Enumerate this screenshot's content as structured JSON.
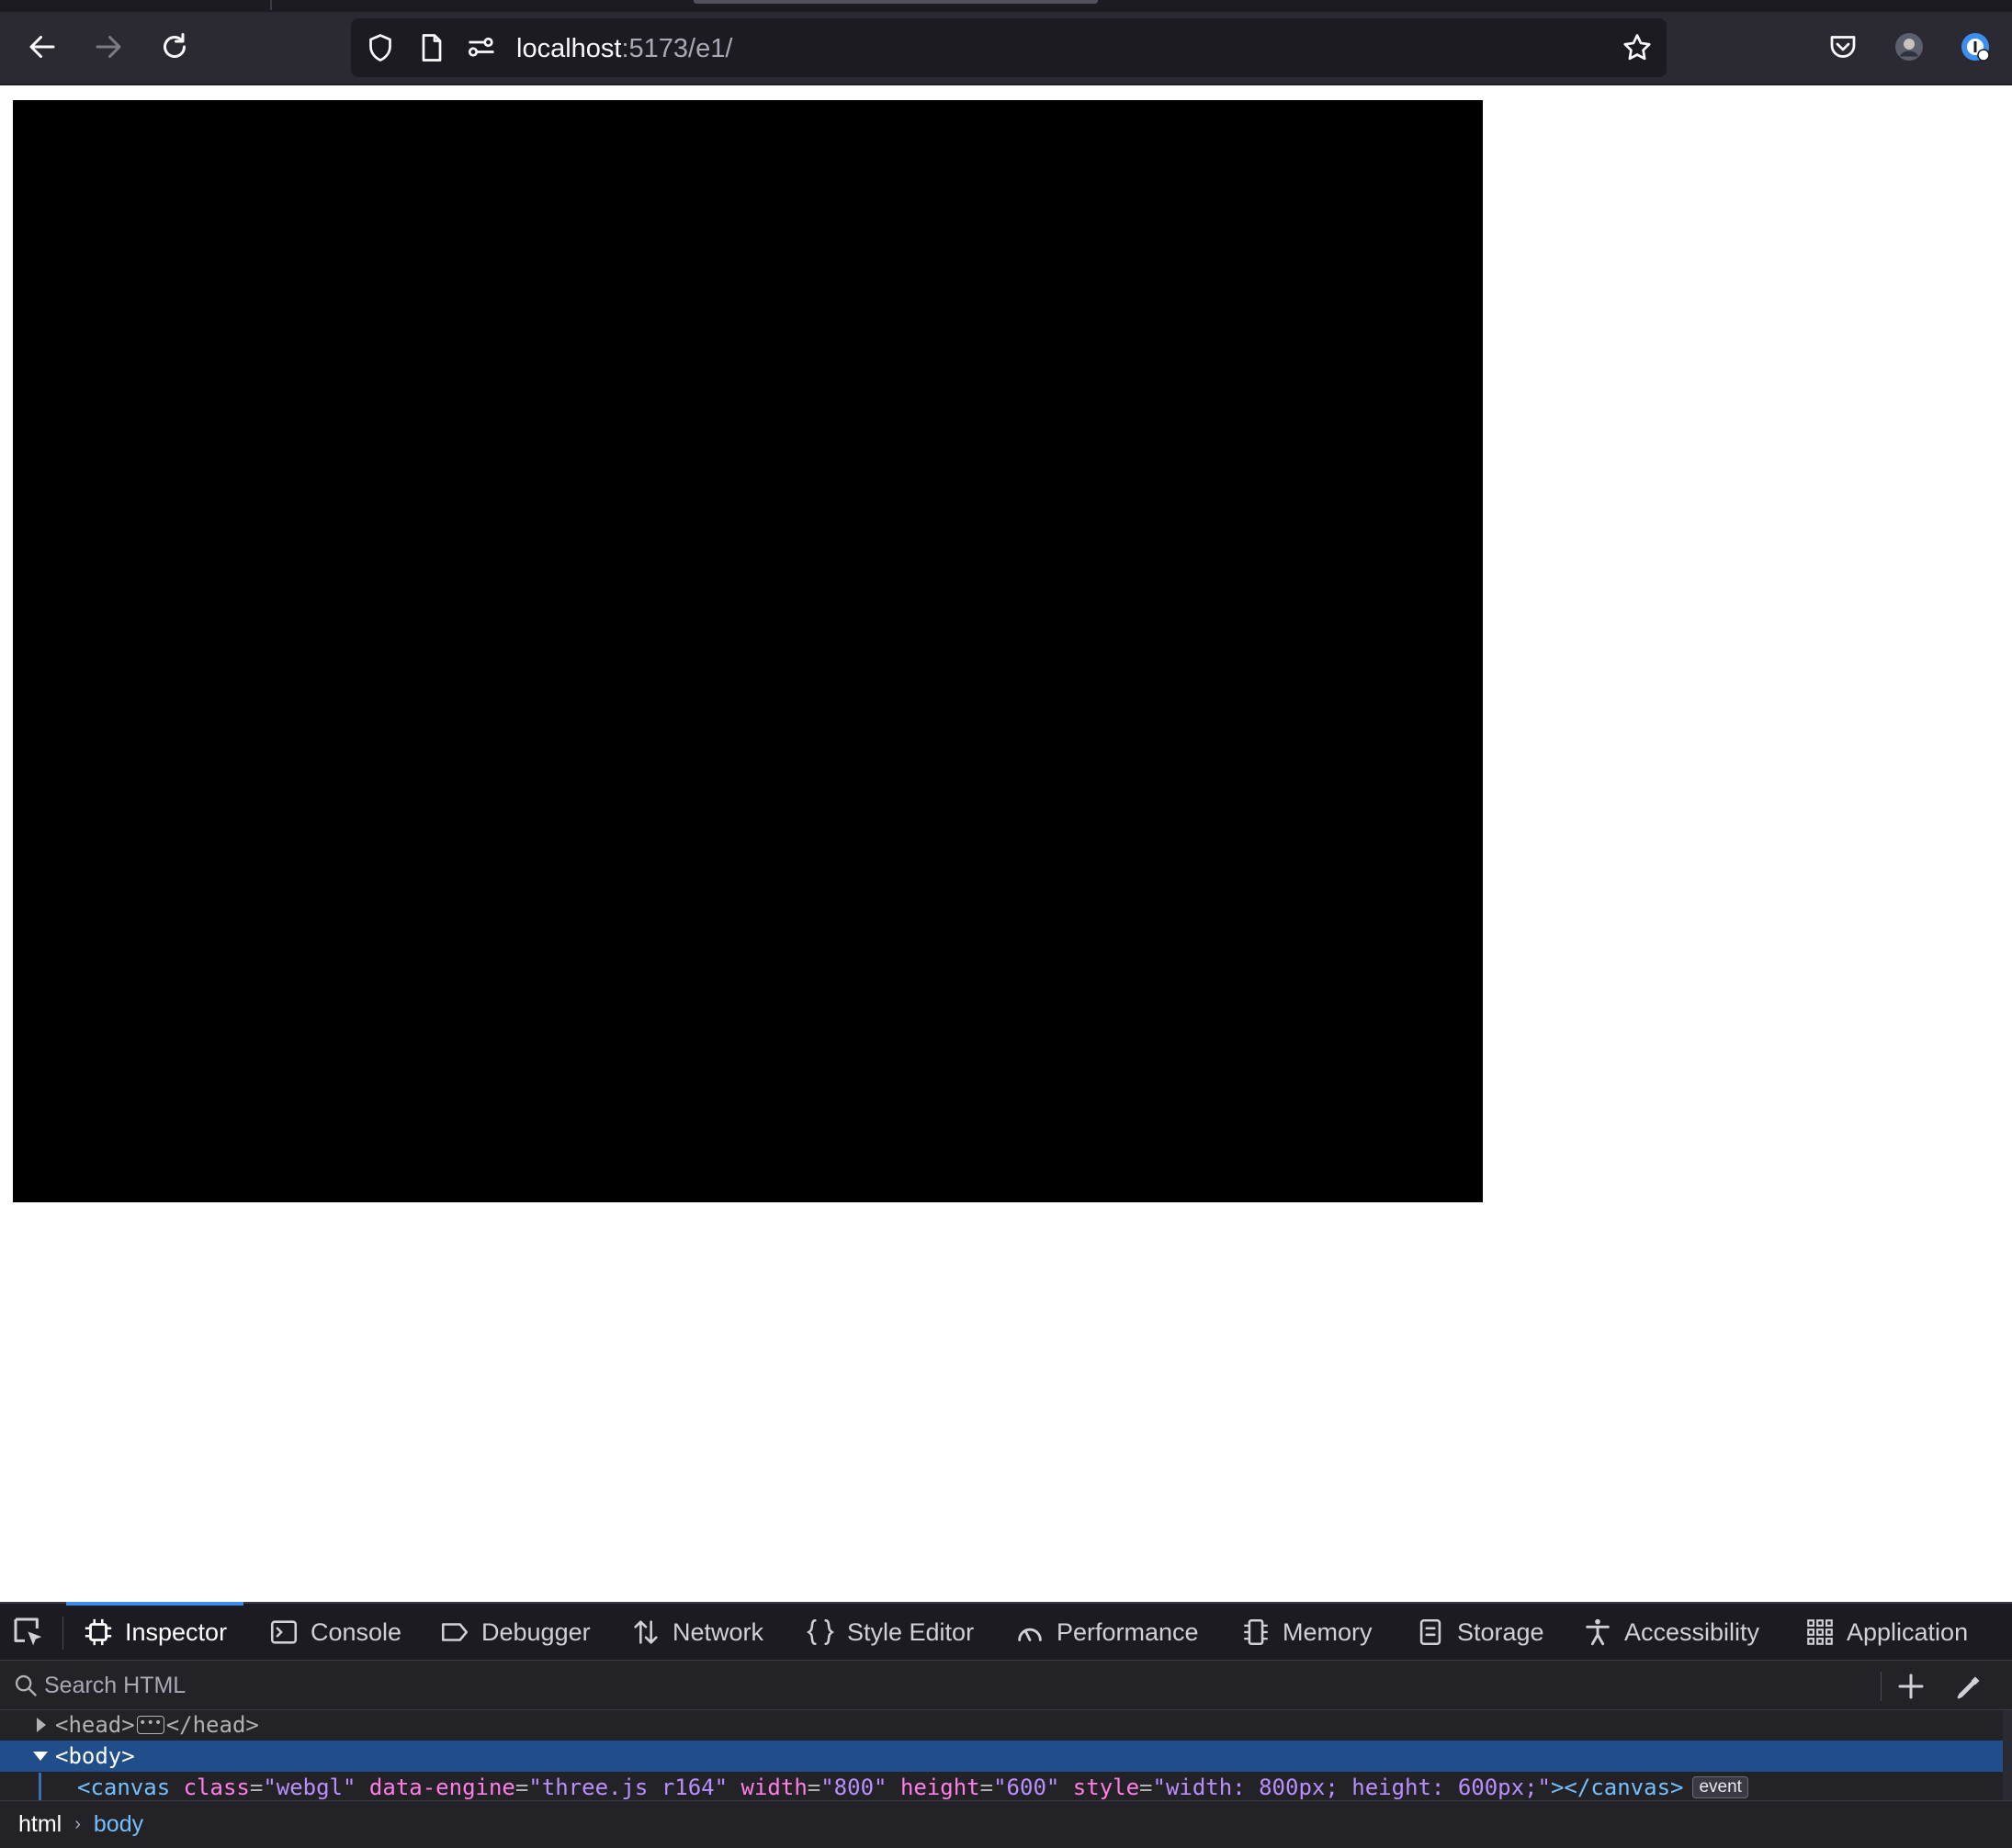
{
  "browser": {
    "url_host": "localhost",
    "url_rest": ":5173/e1/",
    "colors": {
      "toolbar": "#2b2a33",
      "urlbar": "#1c1b22"
    }
  },
  "page": {
    "canvas_color": "#000000"
  },
  "devtools": {
    "tabs": [
      {
        "label": "Inspector",
        "icon": "inspector-icon",
        "selected": true
      },
      {
        "label": "Console",
        "icon": "console-icon"
      },
      {
        "label": "Debugger",
        "icon": "debugger-icon"
      },
      {
        "label": "Network",
        "icon": "network-icon"
      },
      {
        "label": "Style Editor",
        "icon": "style-editor-icon"
      },
      {
        "label": "Performance",
        "icon": "performance-icon"
      },
      {
        "label": "Memory",
        "icon": "memory-icon"
      },
      {
        "label": "Storage",
        "icon": "storage-icon"
      },
      {
        "label": "Accessibility",
        "icon": "accessibility-icon"
      },
      {
        "label": "Application",
        "icon": "application-icon"
      }
    ],
    "search": {
      "placeholder": "Search HTML"
    },
    "markup": {
      "head_open": "<head>",
      "head_close": "</head>",
      "body_open": "<body>",
      "canvas": {
        "open": "<canvas",
        "attrs": [
          {
            "name": "class",
            "value": "\"webgl\""
          },
          {
            "name": "data-engine",
            "value": "\"three.js r164\""
          },
          {
            "name": "width",
            "value": "\"800\""
          },
          {
            "name": "height",
            "value": "\"600\""
          },
          {
            "name": "style",
            "value": "\"width: 800px; height: 600px;\""
          }
        ],
        "close": "></canvas>",
        "badge": "event"
      }
    },
    "breadcrumbs": [
      "html",
      "body"
    ],
    "colors": {
      "selected_row": "#204e8a",
      "accent": "#3b8ff1"
    }
  }
}
